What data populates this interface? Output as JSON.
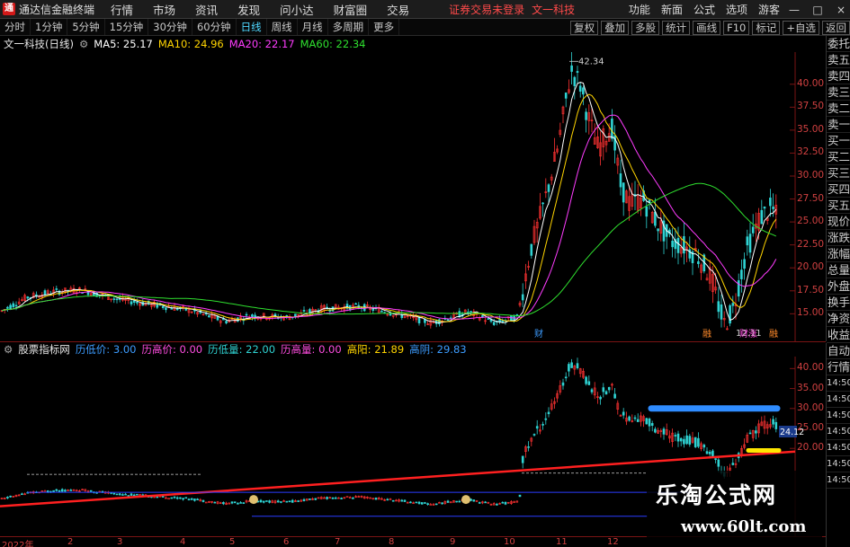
{
  "menubar": {
    "app_title": "通达信金融终端",
    "items": [
      "行情",
      "市场",
      "资讯",
      "发现",
      "问小达",
      "财富圈",
      "交易"
    ],
    "login_hint": "证券交易未登录",
    "stock_name": "文一科技",
    "right_items": [
      "功能",
      "新面",
      "公式",
      "选项",
      "游客"
    ],
    "window_buttons": [
      "—",
      "□",
      "×"
    ]
  },
  "period_bar": {
    "items": [
      "分时",
      "1分钟",
      "5分钟",
      "15分钟",
      "30分钟",
      "60分钟",
      "日线",
      "周线",
      "月线",
      "多周期",
      "更多"
    ],
    "active": "日线",
    "tools": [
      "复权",
      "叠加",
      "多股",
      "统计",
      "画线",
      "F10",
      "标记",
      "+自选",
      "返回"
    ]
  },
  "main_chart": {
    "title": "文一科技(日线)",
    "ma": [
      {
        "label": "MA5: 25.17",
        "color": "#ffffff"
      },
      {
        "label": "MA10: 24.96",
        "color": "#ffd400"
      },
      {
        "label": "MA20: 22.17",
        "color": "#ff3cff"
      },
      {
        "label": "MA60: 22.34",
        "color": "#2fe02f"
      }
    ],
    "y_ticks": [
      "40.00",
      "37.50",
      "35.00",
      "32.50",
      "30.00",
      "27.50",
      "25.00",
      "22.50",
      "20.00",
      "17.50",
      "15.00"
    ],
    "high_label": "42.34",
    "low_label": "12.11",
    "markers": [
      "财",
      "融",
      "财涨",
      "融"
    ]
  },
  "sub_chart": {
    "title": "股票指标网",
    "items": [
      {
        "label": "历低价: 3.00",
        "color": "#3c9cff"
      },
      {
        "label": "历高价: 0.00",
        "color": "#ff4de1"
      },
      {
        "label": "历低量: 22.00",
        "color": "#2fd3d3"
      },
      {
        "label": "历高量: 0.00",
        "color": "#ff4de1"
      },
      {
        "label": "高阳: 21.89",
        "color": "#ffd400"
      },
      {
        "label": "高阴: 29.83",
        "color": "#3c9cff"
      }
    ],
    "y_ticks": [
      "40.00",
      "35.00",
      "30.00",
      "25.00",
      "20.00"
    ],
    "price_tag": "24.12",
    "right_tabs": [
      "自动",
      "行情",
      "14:50",
      "14:50",
      "14:50",
      "14:50",
      "14:50",
      "14:50",
      "14:50"
    ]
  },
  "right_tabs": [
    "委托",
    "卖五",
    "卖四",
    "卖三",
    "卖二",
    "卖一",
    "买一",
    "买二",
    "买三",
    "买四",
    "买五",
    "现价",
    "涨跌",
    "涨幅",
    "总量",
    "外盘",
    "换手",
    "净资",
    "收益"
  ],
  "x_axis": [
    "2022年",
    "2",
    "3",
    "4",
    "5",
    "6",
    "7",
    "8",
    "9",
    "10",
    "11",
    "12"
  ],
  "watermark": {
    "line1": "乐淘公式网",
    "line2": "www.60lt.com"
  }
}
